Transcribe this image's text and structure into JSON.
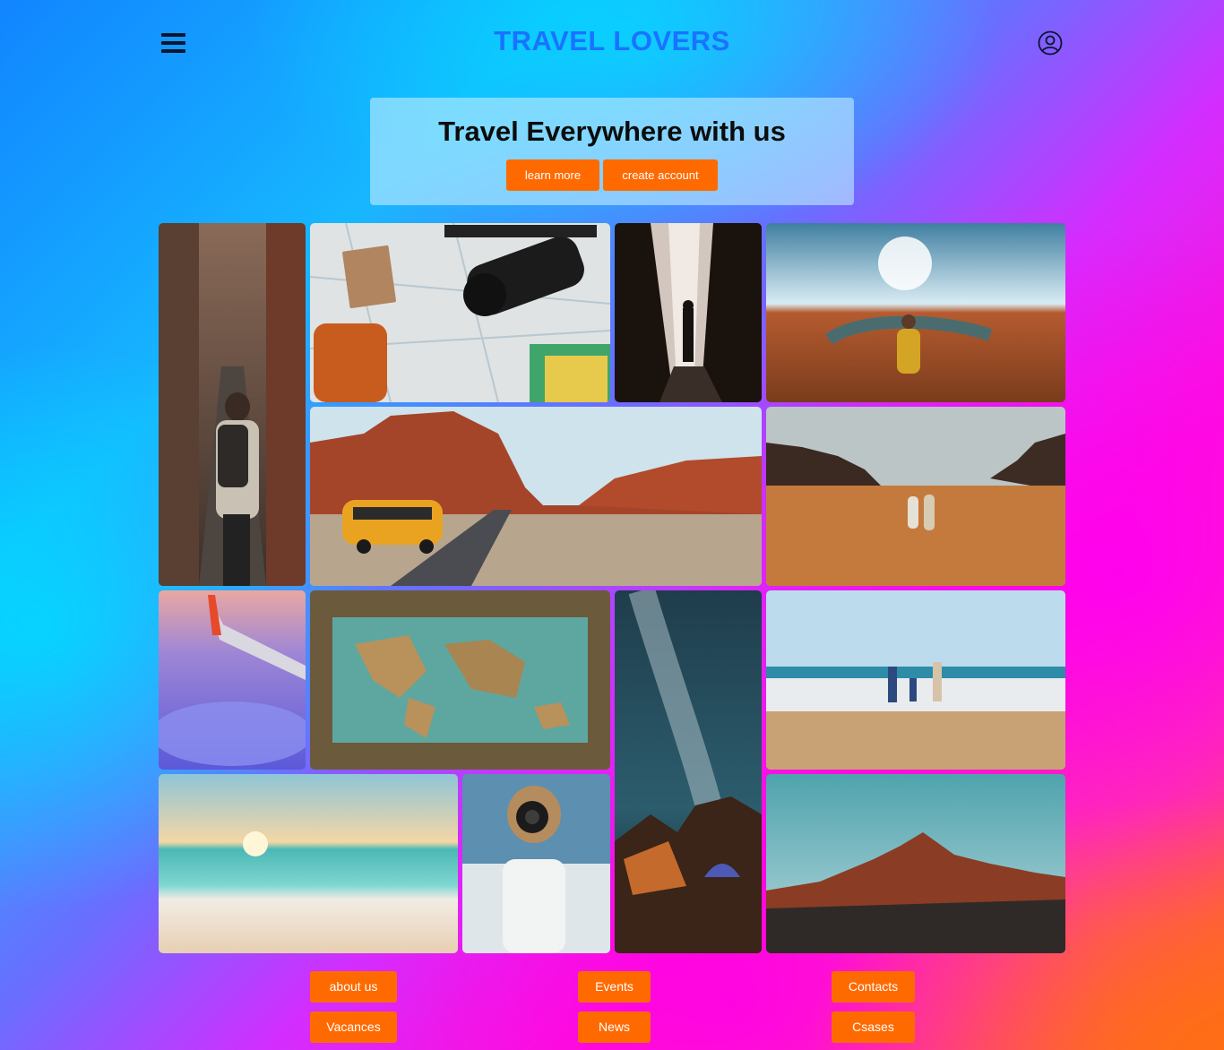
{
  "header": {
    "title": "TRAVEL LOVERS",
    "menu_icon": "hamburger-menu-icon",
    "account_icon": "user-account-icon"
  },
  "hero": {
    "title": "Travel Everywhere with us",
    "learn_more_label": "learn more",
    "create_account_label": "create account"
  },
  "gallery": {
    "photos": [
      "city-alley-backpacker",
      "map-camera-field-notes",
      "canyon-crevice-silhouette",
      "horseshoe-bend-hiker",
      "desert-road-yellow-van",
      "desert-couple-walking",
      "airplane-wing-clouds",
      "world-map-money",
      "milky-way-camping",
      "family-beach-waves",
      "sunset-beach",
      "photographer-camera",
      "red-mountains"
    ]
  },
  "footer": {
    "links": [
      "about us",
      "Events",
      "Contacts",
      "Vacances",
      "News",
      "Csases"
    ]
  },
  "colors": {
    "accent": "#ff6a00",
    "title_blue": "#1a73ff"
  }
}
